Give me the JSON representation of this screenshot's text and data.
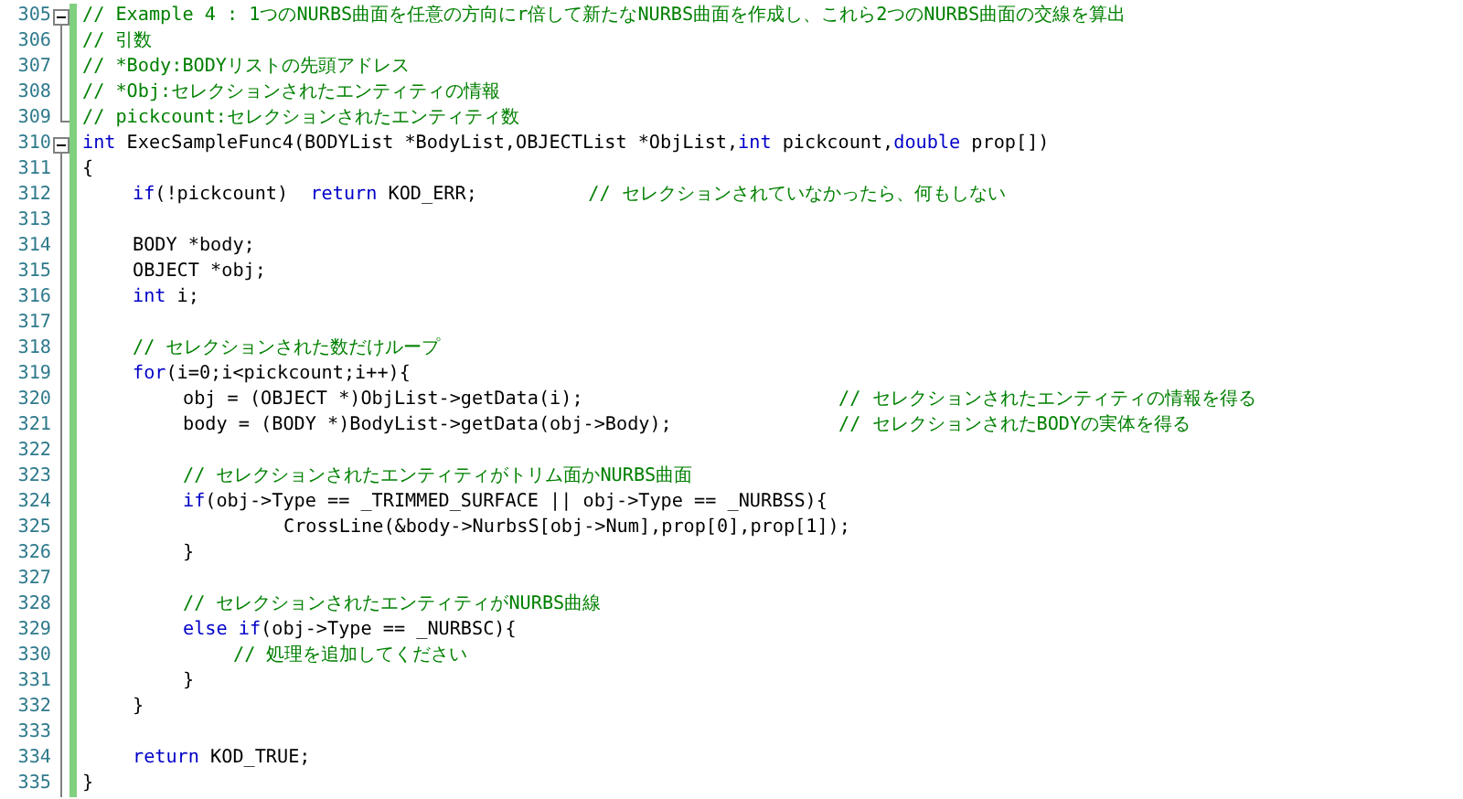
{
  "editor": {
    "lines": [
      {
        "number": "305",
        "kind": "start",
        "tokens": [
          {
            "kind": "comment",
            "text": "// Example 4 : 1つのNURBS曲面を任意の方向にr倍して新たなNURBS曲面を作成し、これら2つのNURBS曲面の交線を算出"
          }
        ]
      },
      {
        "number": "306",
        "kind": "inside",
        "tokens": [
          {
            "kind": "comment",
            "text": "// 引数"
          }
        ]
      },
      {
        "number": "307",
        "kind": "inside",
        "tokens": [
          {
            "kind": "comment",
            "text": "// *Body:BODYリストの先頭アドレス"
          }
        ]
      },
      {
        "number": "308",
        "kind": "inside",
        "tokens": [
          {
            "kind": "comment",
            "text": "// *Obj:セレクションされたエンティティの情報"
          }
        ]
      },
      {
        "number": "309",
        "kind": "end",
        "tokens": [
          {
            "kind": "comment",
            "text": "// pickcount:セレクションされたエンティティ数"
          }
        ]
      },
      {
        "number": "310",
        "kind": "start",
        "tokens": [
          {
            "kind": "keyword",
            "text": "int"
          },
          {
            "kind": "plain",
            "text": " ExecSampleFunc4(BODYList *BodyList,OBJECTList *ObjList,"
          },
          {
            "kind": "keyword",
            "text": "int"
          },
          {
            "kind": "plain",
            "text": " pickcount,"
          },
          {
            "kind": "keyword",
            "text": "double"
          },
          {
            "kind": "plain",
            "text": " prop[])"
          }
        ]
      },
      {
        "number": "311",
        "kind": "inside",
        "tokens": [
          {
            "kind": "plain",
            "text": "{"
          }
        ]
      },
      {
        "number": "312",
        "kind": "inside",
        "tokens": [
          {
            "kind": "keyword",
            "text": "\tif"
          },
          {
            "kind": "plain",
            "text": "(!pickcount)  "
          },
          {
            "kind": "keyword",
            "text": "return"
          },
          {
            "kind": "plain",
            "text": " KOD_ERR;          "
          },
          {
            "kind": "comment",
            "text": "// セレクションされていなかったら、何もしない"
          }
        ]
      },
      {
        "number": "313",
        "kind": "inside"
      },
      {
        "number": "314",
        "kind": "inside",
        "tokens": [
          {
            "kind": "plain",
            "text": "\tBODY *body;"
          }
        ]
      },
      {
        "number": "315",
        "kind": "inside",
        "tokens": [
          {
            "kind": "plain",
            "text": "\tOBJECT *obj;"
          }
        ]
      },
      {
        "number": "316",
        "kind": "inside",
        "tokens": [
          {
            "kind": "keyword",
            "text": "\tint"
          },
          {
            "kind": "plain",
            "text": " i;"
          }
        ]
      },
      {
        "number": "317",
        "kind": "inside"
      },
      {
        "number": "318",
        "kind": "inside",
        "tokens": [
          {
            "kind": "comment",
            "text": "\t// セレクションされた数だけループ"
          }
        ]
      },
      {
        "number": "319",
        "kind": "inside",
        "tokens": [
          {
            "kind": "keyword",
            "text": "\tfor"
          },
          {
            "kind": "plain",
            "text": "(i=0;i<pickcount;i++){"
          }
        ]
      },
      {
        "number": "320",
        "kind": "inside",
        "tokens": [
          {
            "kind": "plain",
            "text": "\t\tobj = (OBJECT *)ObjList->getData(i);                       "
          },
          {
            "kind": "comment",
            "text": "// セレクションされたエンティティの情報を得る"
          }
        ]
      },
      {
        "number": "321",
        "kind": "inside",
        "tokens": [
          {
            "kind": "plain",
            "text": "\t\tbody = (BODY *)BodyList->getData(obj->Body);               "
          },
          {
            "kind": "comment",
            "text": "// セレクションされたBODYの実体を得る"
          }
        ]
      },
      {
        "number": "322",
        "kind": "inside"
      },
      {
        "number": "323",
        "kind": "inside",
        "tokens": [
          {
            "kind": "comment",
            "text": "\t\t// セレクションされたエンティティがトリム面かNURBS曲面"
          }
        ]
      },
      {
        "number": "324",
        "kind": "inside",
        "tokens": [
          {
            "kind": "keyword",
            "text": "\t\tif"
          },
          {
            "kind": "plain",
            "text": "(obj->Type == _TRIMMED_SURFACE || obj->Type == _NURBSS){"
          }
        ]
      },
      {
        "number": "325",
        "kind": "inside",
        "tokens": [
          {
            "kind": "plain",
            "text": "\t\t\t\tCrossLine(&body->NurbsS[obj->Num],prop[0],prop[1]);"
          }
        ]
      },
      {
        "number": "326",
        "kind": "inside",
        "tokens": [
          {
            "kind": "plain",
            "text": "\t\t}"
          }
        ]
      },
      {
        "number": "327",
        "kind": "inside"
      },
      {
        "number": "328",
        "kind": "inside",
        "tokens": [
          {
            "kind": "comment",
            "text": "\t\t// セレクションされたエンティティがNURBS曲線"
          }
        ]
      },
      {
        "number": "329",
        "kind": "inside",
        "tokens": [
          {
            "kind": "keyword",
            "text": "\t\telse if"
          },
          {
            "kind": "plain",
            "text": "(obj->Type == _NURBSC){"
          }
        ]
      },
      {
        "number": "330",
        "kind": "inside",
        "tokens": [
          {
            "kind": "comment",
            "text": "\t\t\t// 処理を追加してください"
          }
        ]
      },
      {
        "number": "331",
        "kind": "inside",
        "tokens": [
          {
            "kind": "plain",
            "text": "\t\t}"
          }
        ]
      },
      {
        "number": "332",
        "kind": "inside",
        "tokens": [
          {
            "kind": "plain",
            "text": "\t}"
          }
        ]
      },
      {
        "number": "333",
        "kind": "inside"
      },
      {
        "number": "334",
        "kind": "inside",
        "tokens": [
          {
            "kind": "keyword",
            "text": "\treturn"
          },
          {
            "kind": "plain",
            "text": " KOD_TRUE;"
          }
        ]
      },
      {
        "number": "335",
        "kind": "inside",
        "tokens": [
          {
            "kind": "plain",
            "text": "}"
          }
        ]
      }
    ]
  }
}
